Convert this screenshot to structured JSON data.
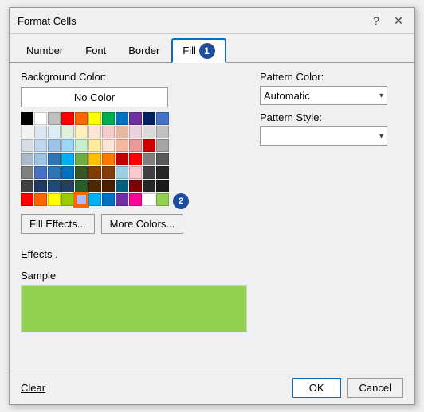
{
  "dialog": {
    "title": "Format Cells",
    "help_icon": "?",
    "close_icon": "✕"
  },
  "tabs": {
    "items": [
      {
        "label": "Number",
        "active": false
      },
      {
        "label": "Font",
        "active": false
      },
      {
        "label": "Border",
        "active": false
      },
      {
        "label": "Fill",
        "active": true,
        "badge": "1"
      }
    ]
  },
  "left": {
    "background_color_label": "Background Color:",
    "no_color_label": "No Color",
    "fill_effects_label": "Fill Effects...",
    "more_colors_label": "More Colors...",
    "effects_label": "Effects ."
  },
  "right": {
    "pattern_color_label": "Pattern Color:",
    "pattern_color_value": "Automatic",
    "pattern_style_label": "Pattern Style:",
    "pattern_style_value": ""
  },
  "sample": {
    "label": "Sample",
    "color": "#92d050"
  },
  "footer": {
    "clear_label": "Clear",
    "ok_label": "OK",
    "cancel_label": "Cancel"
  },
  "colors": {
    "row1": [
      "#000000",
      "#ffffff",
      "#c0c0c0",
      "#00b0f0",
      "#0070c0",
      "#ff9900",
      "#ffff00",
      "#00b050",
      "#ff0000",
      "#7030a0",
      "#002060"
    ],
    "row2": [
      "#ffffff",
      "#f2f2f2",
      "#dce6f1",
      "#dbeef3",
      "#e2efda",
      "#ffeeba",
      "#fce4d6",
      "#f4cccc",
      "#e6b8a2",
      "#ead1dc",
      "#d9d9d9"
    ],
    "row3": [
      "#d9d9d9",
      "#d6dce4",
      "#bdd7ee",
      "#9dc3e6",
      "#9dd7f5",
      "#c6efce",
      "#ffeb9c",
      "#fce4d6",
      "#f4b8a0",
      "#ea9999",
      "#cc0000"
    ],
    "row4": [
      "#a6a6a6",
      "#adb9ca",
      "#9dc3e6",
      "#2e75b6",
      "#00b0f0",
      "#70ad47",
      "#ffc000",
      "#ff7900",
      "#c00000",
      "#ff0000",
      "#7f7f7f"
    ],
    "row5": [
      "#595959",
      "#808080",
      "#4472c4",
      "#2e75b6",
      "#0070c0",
      "#375623",
      "#833c00",
      "#843c0c",
      "#99cfe0",
      "#f9c9ce",
      "#404040"
    ],
    "row6": [
      "#262626",
      "#404040",
      "#1f3864",
      "#1f497d",
      "#244061",
      "#255e28",
      "#4d2700",
      "#4d1f00",
      "#006080",
      "#800000",
      "#262626"
    ],
    "row7": [
      "#ff0000",
      "#ff6600",
      "#ffff00",
      "#99cc00",
      "#aabaff",
      "#00b0f0",
      "#0070c0",
      "#7030a0",
      "#ff0099",
      "#ffffff"
    ],
    "selected_color": "#aabaff",
    "selected_row": 6,
    "selected_col": 4
  }
}
